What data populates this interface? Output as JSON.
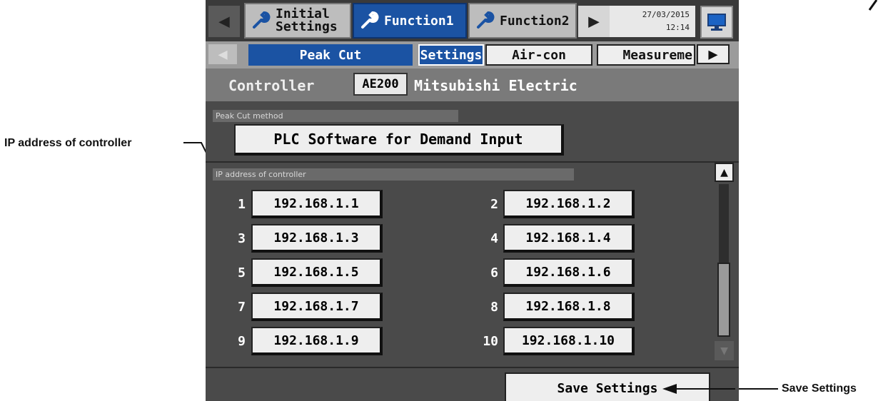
{
  "top_tabs": [
    {
      "label": "Initial\nSettings",
      "active": false
    },
    {
      "label": "Function1",
      "active": true
    },
    {
      "label": "Function2",
      "active": false
    }
  ],
  "datetime": {
    "date": "27/03/2015",
    "time": "12:14"
  },
  "sub_tabs": {
    "section": "Peak Cut",
    "settings": "Settings",
    "aircon": "Air-con",
    "measurement": "Measureme"
  },
  "controller": {
    "label": "Controller",
    "model": "AE200",
    "name": "Mitsubishi Electric"
  },
  "peak_cut": {
    "section_label": "Peak Cut method",
    "method": "PLC Software for Demand Input"
  },
  "ip_section_label": "IP address of controller",
  "ip_addresses": [
    {
      "num": "1",
      "ip": "192.168.1.1"
    },
    {
      "num": "2",
      "ip": "192.168.1.2"
    },
    {
      "num": "3",
      "ip": "192.168.1.3"
    },
    {
      "num": "4",
      "ip": "192.168.1.4"
    },
    {
      "num": "5",
      "ip": "192.168.1.5"
    },
    {
      "num": "6",
      "ip": "192.168.1.6"
    },
    {
      "num": "7",
      "ip": "192.168.1.7"
    },
    {
      "num": "8",
      "ip": "192.168.1.8"
    },
    {
      "num": "9",
      "ip": "192.168.1.9"
    },
    {
      "num": "10",
      "ip": "192.168.1.10"
    }
  ],
  "save_label": "Save Settings",
  "annotations": {
    "ip": "IP address of controller",
    "save": "Save Settings"
  },
  "colors": {
    "active_tab": "#1b53a3",
    "background": "#4a4a4a"
  }
}
